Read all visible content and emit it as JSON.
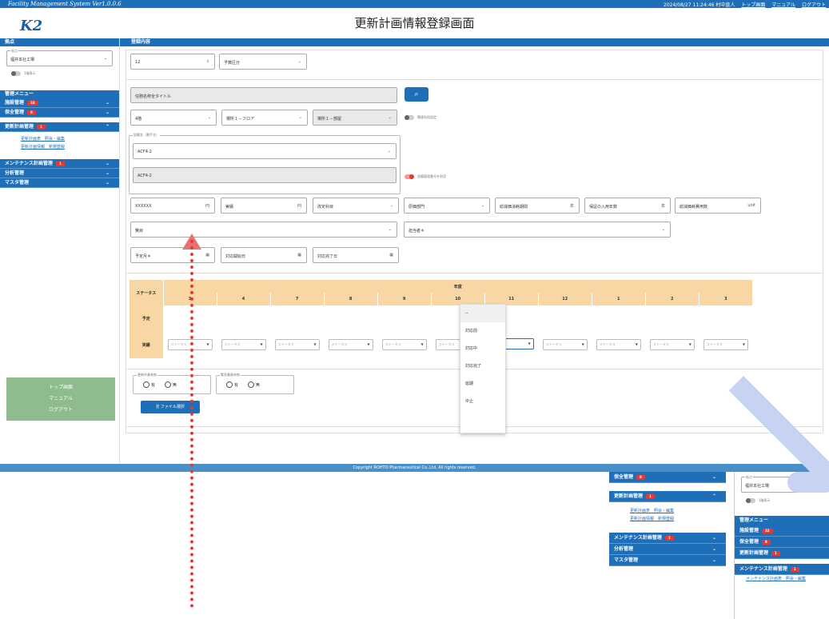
{
  "header": {
    "system_name": "Facility Management System",
    "version": "Ver1.0.0.6",
    "datetime_user": "2024/08/27 11:24:46  村中直人",
    "links": [
      "トップ画面",
      "マニュアル",
      "ログアウト"
    ],
    "logo": "K2",
    "page_title": "更新計画情報登録画面",
    "footer": "Copyright ROHTO Pharmaceutical Co.,Ltd. All rights reserved."
  },
  "sidebar": {
    "base_header": "拠点",
    "base_label": "拠点",
    "base_value": "福井本社工場",
    "toggle_label": "1階表示",
    "menu_header": "管理メニュー",
    "menu": [
      {
        "label": "施設管理",
        "badge": "33"
      },
      {
        "label": "保全管理",
        "badge": "8"
      },
      {
        "label": "更新計画管理",
        "badge": "1"
      }
    ],
    "sub_links": [
      "更新計画表　照会・編集",
      "更新計画情報　新規登録"
    ],
    "menu2": [
      {
        "label": "メンテナンス計画管理",
        "badge": "1"
      },
      {
        "label": "分析管理",
        "badge": ""
      },
      {
        "label": "マスタ管理",
        "badge": ""
      }
    ],
    "bottom_links": [
      "トップ画面",
      "マニュアル",
      "ログアウト"
    ]
  },
  "main": {
    "section_header": "登録内容",
    "fiscal_year": "12",
    "budget_type": "予算区分",
    "title_placeholder": "任務名称全タイトル",
    "floor": "4階",
    "area": "場所１－フロア",
    "place": "場所１－部屋",
    "related_label": "関連利用設定",
    "equip_group": "設備名（番手名）",
    "equip_no": "ACF4-2",
    "equip_no_disabled": "ACF4-2",
    "toggle_label": "設備管理番号を利用",
    "amount": "XXXXXX",
    "actual": "実績",
    "plan_type": "改定科目",
    "dept": "原価部門",
    "life1": "総減価消耗期間",
    "life2": "保証の入用年数",
    "life3": "総減価耗費用数",
    "unit": "unit",
    "contents": "費目",
    "person": "担当者＊",
    "plan_date": "予定月＊",
    "start_date": "対応開始日",
    "end_date": "対応完了日",
    "table": {
      "status_label": "ステータス",
      "year_label": "年度",
      "months": [
        "3",
        "4",
        "7",
        "8",
        "9",
        "10",
        "11",
        "12",
        "1",
        "2",
        "3"
      ],
      "rows": [
        "予定",
        "実績"
      ],
      "cell_placeholder": "ステータス"
    },
    "dropdown": [
      "--",
      "対応前",
      "対応中",
      "対応完了",
      "延期",
      "中止"
    ],
    "radio1": {
      "label": "更新作業有無",
      "options": [
        "有",
        "無"
      ]
    },
    "radio2": {
      "label": "緊急業務有無",
      "options": [
        "有",
        "無"
      ]
    },
    "file_button": "ファイル選択"
  },
  "mini_sidebar": {
    "left": [
      {
        "label": "保全管理",
        "badge": "8"
      },
      {
        "label": "更新計画管理",
        "badge": "1"
      }
    ],
    "left_links": [
      "更新計画表　照会・編集",
      "更新計画情報　新規登録"
    ],
    "left2": [
      {
        "label": "メンテナンス計画管理",
        "badge": "1"
      },
      {
        "label": "分析管理",
        "badge": ""
      },
      {
        "label": "マスタ管理",
        "badge": ""
      }
    ],
    "right_base": "福井本社工場",
    "right_toggle": "1階表示",
    "right_menu_header": "管理メニュー",
    "right_menu": [
      {
        "label": "施設管理",
        "badge": "33"
      },
      {
        "label": "保全管理",
        "badge": "8"
      },
      {
        "label": "更新計画管理",
        "badge": "1"
      },
      {
        "label": "メンテナンス計画管理",
        "badge": "1"
      }
    ],
    "right_sub": "メンテナンス計画表　照会・編集"
  }
}
